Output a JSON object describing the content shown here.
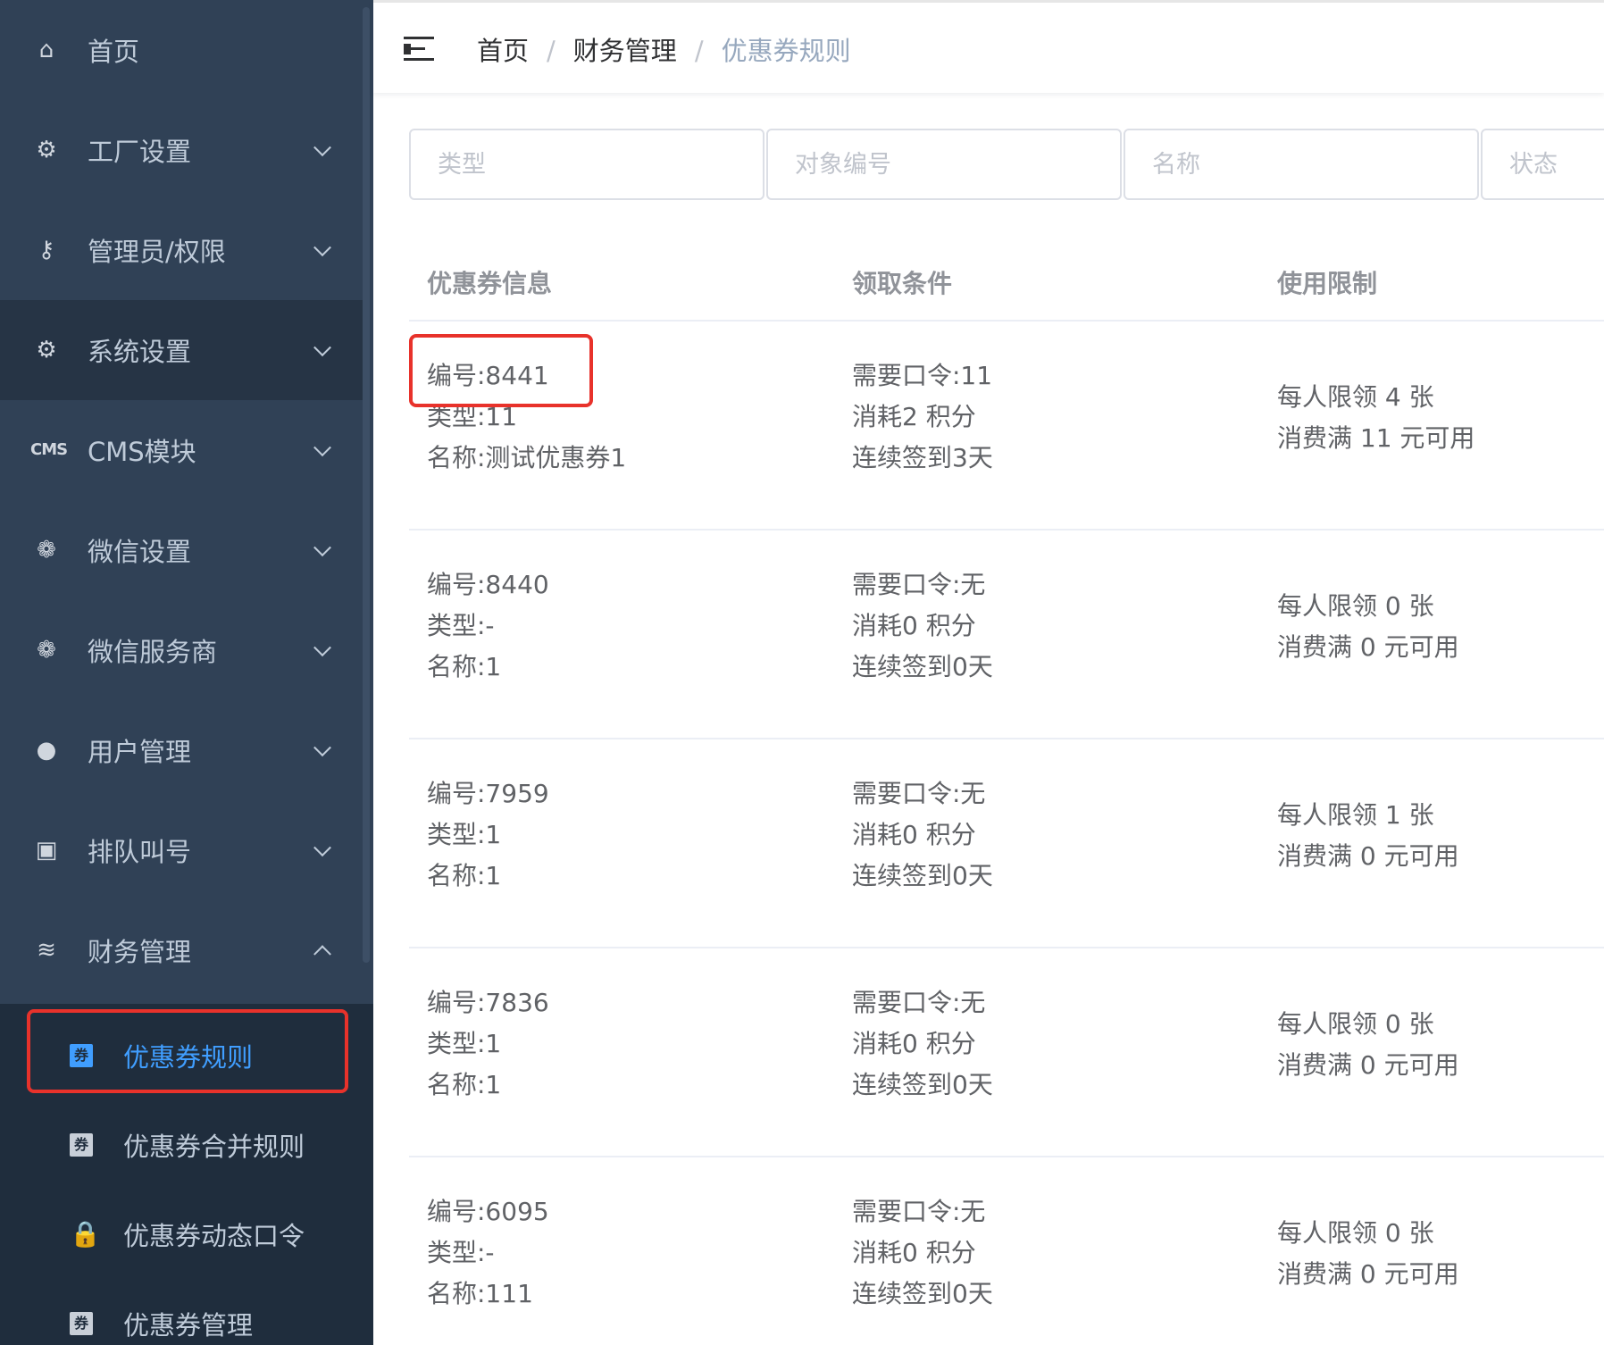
{
  "sidebar": {
    "items": [
      {
        "label": "首页",
        "icon": "home-icon",
        "glyph": "⌂",
        "arrow": ""
      },
      {
        "label": "工厂设置",
        "icon": "gear-icon",
        "glyph": "⚙",
        "arrow": "down"
      },
      {
        "label": "管理员/权限",
        "icon": "admin-key-icon",
        "glyph": "⚷",
        "arrow": "down"
      },
      {
        "label": "系统设置",
        "icon": "gear-icon",
        "glyph": "⚙",
        "arrow": "down"
      },
      {
        "label": "CMS模块",
        "icon": "cms-icon",
        "glyph": "CMS",
        "arrow": "down"
      },
      {
        "label": "微信设置",
        "icon": "wechat-icon",
        "glyph": "❁",
        "arrow": "down"
      },
      {
        "label": "微信服务商",
        "icon": "wechat-icon",
        "glyph": "❁",
        "arrow": "down"
      },
      {
        "label": "用户管理",
        "icon": "user-icon",
        "glyph": "●",
        "arrow": "down"
      },
      {
        "label": "排队叫号",
        "icon": "monitor-icon",
        "glyph": "▣",
        "arrow": "down"
      },
      {
        "label": "财务管理",
        "icon": "database-icon",
        "glyph": "≋",
        "arrow": "up"
      }
    ],
    "submenu": [
      {
        "label": "优惠券规则",
        "icon": "coupon-icon",
        "glyph": "券",
        "selected": true
      },
      {
        "label": "优惠券合并规则",
        "icon": "coupon-icon",
        "glyph": "券",
        "selected": false
      },
      {
        "label": "优惠券动态口令",
        "icon": "lock-icon",
        "glyph": "🔒",
        "selected": false
      },
      {
        "label": "优惠券管理",
        "icon": "coupon-icon",
        "glyph": "券",
        "selected": false
      }
    ]
  },
  "breadcrumb": {
    "items": [
      "首页",
      "财务管理",
      "优惠券规则"
    ],
    "separator": "/"
  },
  "filters": {
    "type_placeholder": "类型",
    "target_placeholder": "对象编号",
    "name_placeholder": "名称",
    "status_placeholder": "状态"
  },
  "table": {
    "headers": {
      "info": "优惠券信息",
      "condition": "领取条件",
      "limit": "使用限制"
    },
    "rows": [
      {
        "id": "编号:8441",
        "type": "类型:11",
        "name": "名称:测试优惠券1",
        "password": "需要口令:11",
        "cost": "消耗2 积分",
        "signin": "连续签到3天",
        "per_person": "每人限领 4 张",
        "min_spend": "消费满 11 元可用"
      },
      {
        "id": "编号:8440",
        "type": "类型:-",
        "name": "名称:1",
        "password": "需要口令:无",
        "cost": "消耗0 积分",
        "signin": "连续签到0天",
        "per_person": "每人限领 0 张",
        "min_spend": "消费满 0 元可用"
      },
      {
        "id": "编号:7959",
        "type": "类型:1",
        "name": "名称:1",
        "password": "需要口令:无",
        "cost": "消耗0 积分",
        "signin": "连续签到0天",
        "per_person": "每人限领 1 张",
        "min_spend": "消费满 0 元可用"
      },
      {
        "id": "编号:7836",
        "type": "类型:1",
        "name": "名称:1",
        "password": "需要口令:无",
        "cost": "消耗0 积分",
        "signin": "连续签到0天",
        "per_person": "每人限领 0 张",
        "min_spend": "消费满 0 元可用"
      },
      {
        "id": "编号:6095",
        "type": "类型:-",
        "name": "名称:111",
        "password": "需要口令:无",
        "cost": "消耗0 积分",
        "signin": "连续签到0天",
        "per_person": "每人限领 0 张",
        "min_spend": "消费满 0 元可用"
      }
    ]
  },
  "colors": {
    "sidebar_bg": "#304156",
    "submenu_bg": "#1f2d3d",
    "accent": "#409eff",
    "highlight_box": "#e8322b"
  }
}
